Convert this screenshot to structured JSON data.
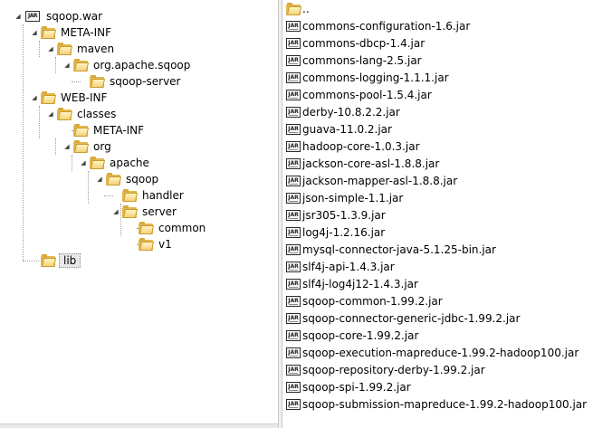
{
  "tree": {
    "root": {
      "label": "sqoop.war",
      "icon": "jar-archive-icon",
      "badge": "JAR"
    },
    "nodes": [
      {
        "label": "META-INF"
      },
      {
        "label": "maven"
      },
      {
        "label": "org.apache.sqoop"
      },
      {
        "label": "sqoop-server"
      },
      {
        "label": "WEB-INF"
      },
      {
        "label": "classes"
      },
      {
        "label": "META-INF"
      },
      {
        "label": "org"
      },
      {
        "label": "apache"
      },
      {
        "label": "sqoop"
      },
      {
        "label": "handler"
      },
      {
        "label": "server"
      },
      {
        "label": "common"
      },
      {
        "label": "v1"
      },
      {
        "label": "lib",
        "selected": true
      }
    ]
  },
  "filelist": {
    "parent_label": "..",
    "jar_badge": "JAR",
    "files": [
      "commons-configuration-1.6.jar",
      "commons-dbcp-1.4.jar",
      "commons-lang-2.5.jar",
      "commons-logging-1.1.1.jar",
      "commons-pool-1.5.4.jar",
      "derby-10.8.2.2.jar",
      "guava-11.0.2.jar",
      "hadoop-core-1.0.3.jar",
      "jackson-core-asl-1.8.8.jar",
      "jackson-mapper-asl-1.8.8.jar",
      "json-simple-1.1.jar",
      "jsr305-1.3.9.jar",
      "log4j-1.2.16.jar",
      "mysql-connector-java-5.1.25-bin.jar",
      "slf4j-api-1.4.3.jar",
      "slf4j-log4j12-1.4.3.jar",
      "sqoop-common-1.99.2.jar",
      "sqoop-connector-generic-jdbc-1.99.2.jar",
      "sqoop-core-1.99.2.jar",
      "sqoop-execution-mapreduce-1.99.2-hadoop100.jar",
      "sqoop-repository-derby-1.99.2.jar",
      "sqoop-spi-1.99.2.jar",
      "sqoop-submission-mapreduce-1.99.2-hadoop100.jar"
    ]
  },
  "colors": {
    "folder": "#e2b84b",
    "selection": "#e8e8e8",
    "tree_lines": "#a0a0a0"
  }
}
